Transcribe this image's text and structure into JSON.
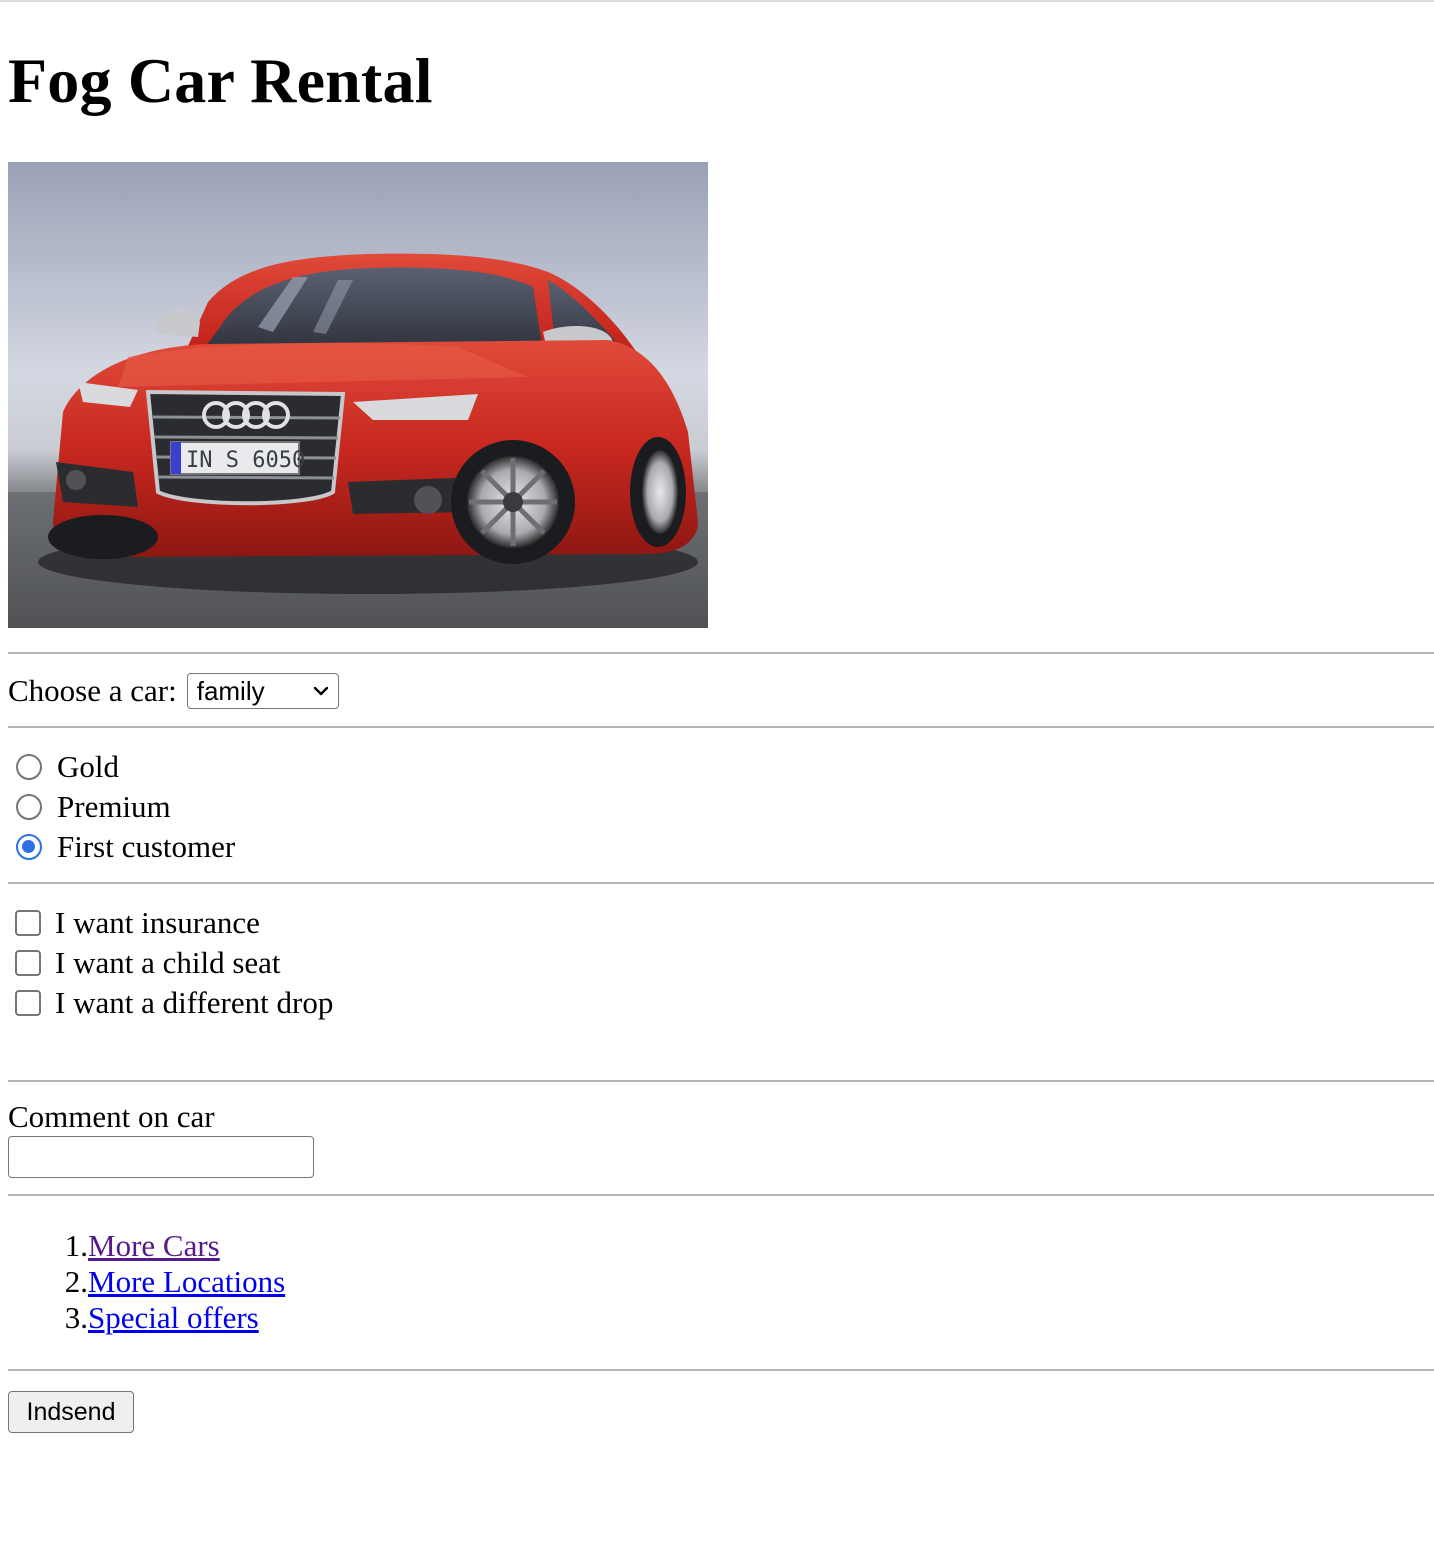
{
  "page": {
    "title": "Fog Car Rental"
  },
  "hero": {
    "alt": "Red Audi sedan",
    "plate_text": "IN S 6050"
  },
  "car_select": {
    "label": "Choose a car:",
    "selected": "family"
  },
  "membership": [
    {
      "label": "Gold",
      "checked": false
    },
    {
      "label": "Premium",
      "checked": false
    },
    {
      "label": "First customer",
      "checked": true
    }
  ],
  "extras": [
    {
      "label": "I want insurance",
      "checked": false
    },
    {
      "label": "I want a child seat",
      "checked": false
    },
    {
      "label": "I want a different drop",
      "checked": false
    }
  ],
  "comment": {
    "label": "Comment on car",
    "value": ""
  },
  "links": [
    {
      "num": "1.",
      "label": "More Cars",
      "visited": true
    },
    {
      "num": "2.",
      "label": "More Locations",
      "visited": false
    },
    {
      "num": "3.",
      "label": "Special offers",
      "visited": false
    }
  ],
  "submit": {
    "label": "Indsend"
  },
  "colors": {
    "link": "#0000ee",
    "visited_link": "#551a8b",
    "radio_accent": "#2f6fe8",
    "car_red": "#c7281f"
  },
  "icons": {
    "select_arrow": "chevron-down-icon"
  }
}
